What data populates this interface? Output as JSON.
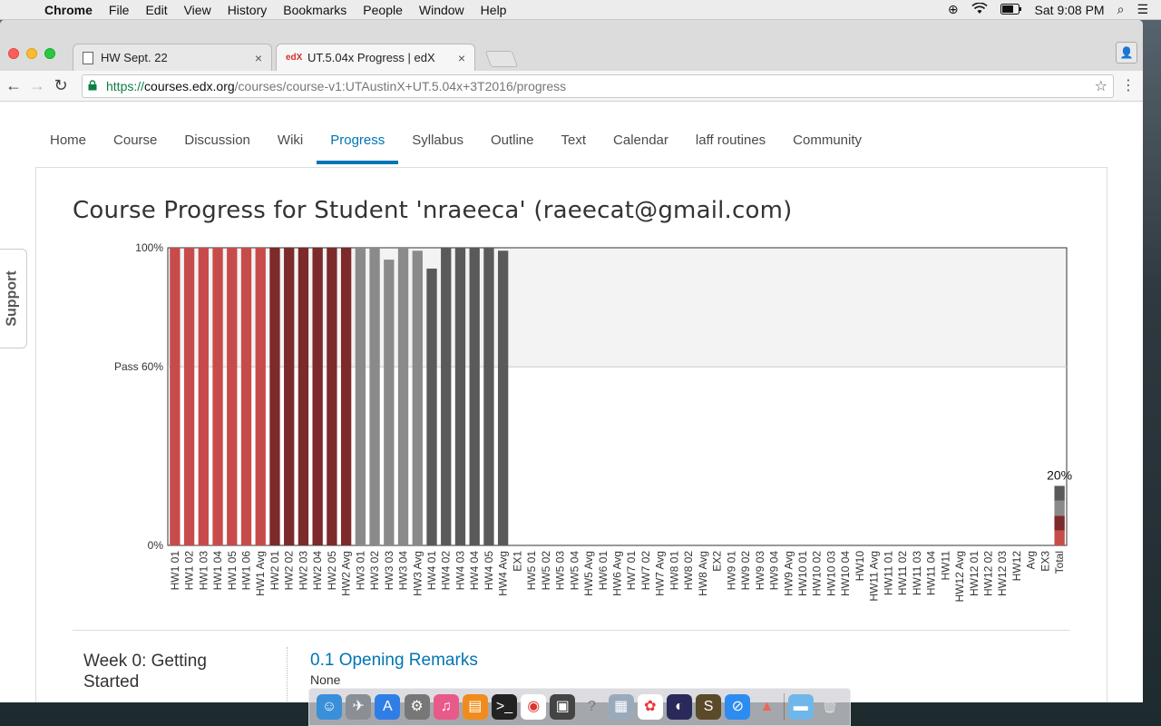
{
  "menubar": {
    "app": "Chrome",
    "items": [
      "File",
      "Edit",
      "View",
      "History",
      "Bookmarks",
      "People",
      "Window",
      "Help"
    ],
    "clock": "Sat 9:08 PM"
  },
  "tabs": [
    {
      "title": "HW Sept. 22",
      "favicon": "doc-icon"
    },
    {
      "title": "UT.5.04x Progress | edX",
      "favicon": "edx-icon"
    }
  ],
  "omnibox": {
    "scheme": "https://",
    "host": "courses.edx.org",
    "path": "/courses/course-v1:UTAustinX+UT.5.04x+3T2016/progress"
  },
  "coursenav": {
    "items": [
      "Home",
      "Course",
      "Discussion",
      "Wiki",
      "Progress",
      "Syllabus",
      "Outline",
      "Text",
      "Calendar",
      "laff routines",
      "Community"
    ],
    "active": "Progress"
  },
  "page_title": "Course Progress for Student 'nraeeca' (raeecat@gmail.com)",
  "support_label": "Support",
  "week": {
    "title": "Week 0: Getting Started",
    "section_title": "0.1 Opening Remarks",
    "section_sub": "None"
  },
  "colors": {
    "hw1": "#c84b4b",
    "hw2": "#7d2a2a",
    "hw3": "#8a8a8a",
    "hw4": "#5a5a5a",
    "accent": "#0075b4"
  },
  "chart_data": {
    "type": "bar",
    "ylabels": [
      "100%",
      "Pass 60%",
      "0%"
    ],
    "ylim": [
      0,
      100
    ],
    "pass_line": 60,
    "categories": [
      "HW1 01",
      "HW1 02",
      "HW1 03",
      "HW1 04",
      "HW1 05",
      "HW1 06",
      "HW1 Avg",
      "HW2 01",
      "HW2 02",
      "HW2 03",
      "HW2 04",
      "HW2 05",
      "HW2 Avg",
      "HW3 01",
      "HW3 02",
      "HW3 03",
      "HW3 04",
      "HW3 Avg",
      "HW4 01",
      "HW4 02",
      "HW4 03",
      "HW4 04",
      "HW4 05",
      "HW4 Avg",
      "EX1",
      "HW5 01",
      "HW5 02",
      "HW5 03",
      "HW5 04",
      "HW5 Avg",
      "HW6 01",
      "HW6 Avg",
      "HW7 01",
      "HW7 02",
      "HW7 Avg",
      "HW8 01",
      "HW8 02",
      "HW8 Avg",
      "EX2",
      "HW9 01",
      "HW9 02",
      "HW9 03",
      "HW9 04",
      "HW9 Avg",
      "HW10 01",
      "HW10 02",
      "HW10 03",
      "HW10 04",
      "HW10",
      "HW11 Avg",
      "HW11 01",
      "HW11 02",
      "HW11 03",
      "HW11 04",
      "HW11",
      "HW12 Avg",
      "HW12 01",
      "HW12 02",
      "HW12 03",
      "HW12",
      "Avg",
      "EX3",
      "Total"
    ],
    "values": [
      100,
      100,
      100,
      100,
      100,
      100,
      100,
      100,
      100,
      100,
      100,
      100,
      100,
      100,
      100,
      96,
      100,
      99,
      93,
      100,
      100,
      100,
      100,
      99,
      0,
      0,
      0,
      0,
      0,
      0,
      0,
      0,
      0,
      0,
      0,
      0,
      0,
      0,
      0,
      0,
      0,
      0,
      0,
      0,
      0,
      0,
      0,
      0,
      0,
      0,
      0,
      0,
      0,
      0,
      0,
      0,
      0,
      0,
      0,
      0,
      0,
      0,
      0
    ],
    "series_colors": [
      "hw1",
      "hw1",
      "hw1",
      "hw1",
      "hw1",
      "hw1",
      "hw1",
      "hw2",
      "hw2",
      "hw2",
      "hw2",
      "hw2",
      "hw2",
      "hw3",
      "hw3",
      "hw3",
      "hw3",
      "hw3",
      "hw4",
      "hw4",
      "hw4",
      "hw4",
      "hw4",
      "hw4"
    ],
    "total": {
      "label": "20%",
      "segments": [
        {
          "value": 5,
          "color": "hw1"
        },
        {
          "value": 5,
          "color": "hw2"
        },
        {
          "value": 5,
          "color": "hw3"
        },
        {
          "value": 5,
          "color": "hw4"
        }
      ]
    },
    "grid": false,
    "legend": "none"
  }
}
